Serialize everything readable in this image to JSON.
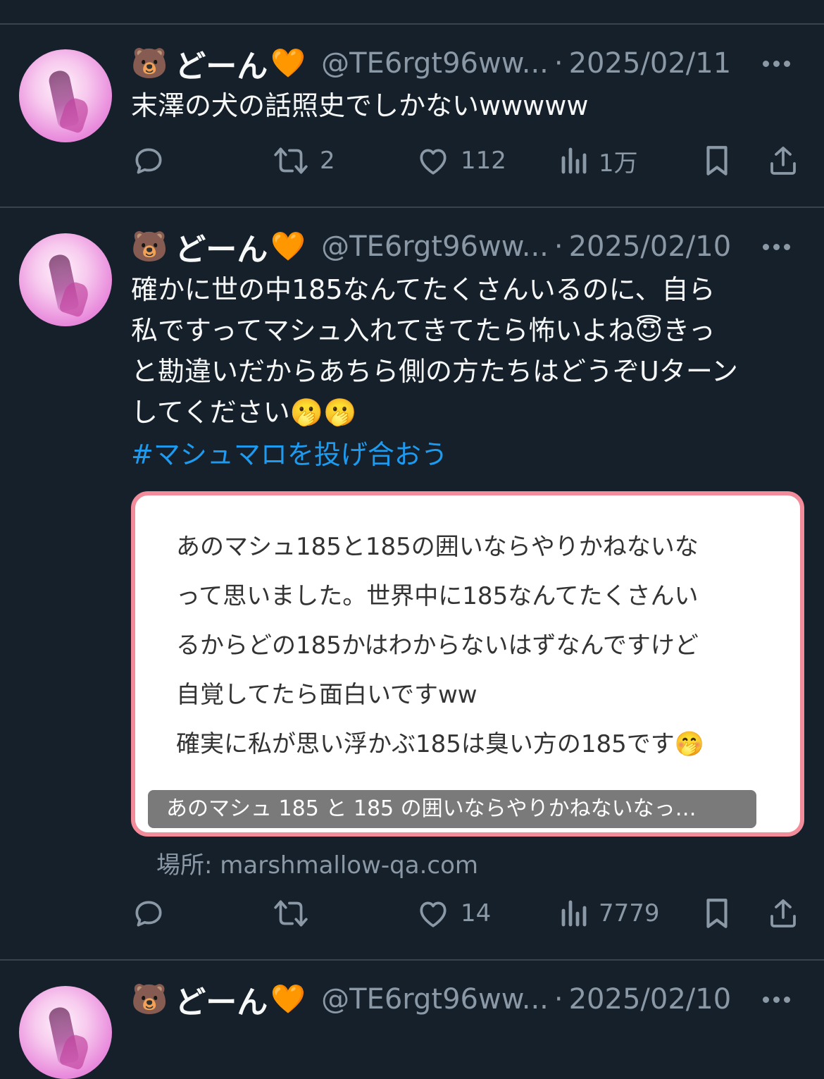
{
  "colors": {
    "background": "#15202b",
    "text": "#f7f9f9",
    "muted": "#8b98a5",
    "link": "#1d9bf0",
    "card_border": "#f28c9a"
  },
  "tweets": [
    {
      "emoji": "🐻",
      "display_name": "どーん",
      "heart": "🧡",
      "handle": "@TE6rgt96ww...",
      "separator": "·",
      "date": "2025/02/11",
      "text": "末澤の犬の話照史でしかないwwwww",
      "replies": "",
      "retweets": "2",
      "likes": "112",
      "views": "1万"
    },
    {
      "emoji": "🐻",
      "display_name": "どーん",
      "heart": "🧡",
      "handle": "@TE6rgt96ww...",
      "separator": "·",
      "date": "2025/02/10",
      "text": "確かに世の中185なんてたくさんいるのに、自ら\n私ですってマシュ入れてきてたら怖いよね😇きっ\nと勘違いだからあちら側の方たちはどうぞUターン\nしてください🫢🫢",
      "hashtag": "#マシュマロを投げ合おう",
      "card": {
        "line1": "あのマシュ185と185の囲いならやりかねないな",
        "line2": "って思いました。世界中に185なんてたくさんい",
        "line3": "るからどの185かはわからないはずなんですけど",
        "line4": "自覚してたら面白いですww",
        "line5": "確実に私が思い浮かぶ185は臭い方の185です🤭",
        "caption": "あのマシュ 185 と 185 の囲いならやりかねないなっ…"
      },
      "source": "場所: marshmallow-qa.com",
      "replies": "",
      "retweets": "",
      "likes": "14",
      "views": "7779"
    },
    {
      "emoji": "🐻",
      "display_name": "どーん",
      "heart": "🧡",
      "handle": "@TE6rgt96ww...",
      "separator": "·",
      "date": "2025/02/10"
    }
  ]
}
